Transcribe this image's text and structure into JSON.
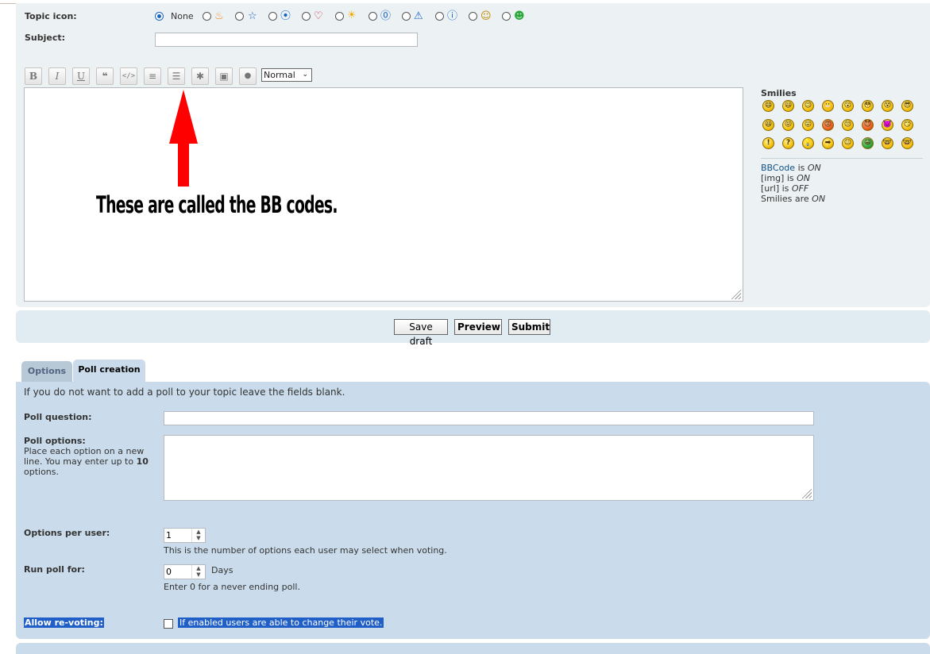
{
  "topic_icon": {
    "label": "Topic icon:",
    "none_label": "None",
    "icons": [
      "flame-icon",
      "star-icon",
      "paw-icon",
      "heart-icon",
      "sun-icon",
      "question-icon",
      "warning-icon",
      "info-icon",
      "smile-icon",
      "grin-icon"
    ]
  },
  "subject": {
    "label": "Subject:",
    "value": ""
  },
  "toolbar": {
    "bold": "B",
    "italic": "I",
    "underline": "U",
    "quote": "❝",
    "code": "</>",
    "list": "≡",
    "list_numbered": "☰",
    "list_item": "✱",
    "image": "▣",
    "color": "●",
    "font_size": "Normal"
  },
  "annotation": {
    "text": "These are called the BB codes."
  },
  "smilies": {
    "title": "Smilies",
    "rows": [
      [
        "😄",
        "😃",
        "😉",
        "😬",
        "😮",
        "😳",
        "😵",
        "😎"
      ],
      [
        "😆",
        "😝",
        "😛",
        "😡",
        "😒",
        "😈",
        "👿",
        "😏"
      ],
      [
        "!",
        "?",
        "💡",
        "➡",
        "😐",
        "😁",
        "🤓",
        "🤓"
      ]
    ]
  },
  "bbcode_status": {
    "bbcode_link": "BBCode",
    "bbcode_is": "is",
    "bbcode_value": "ON",
    "img_label": "[img] is",
    "img_value": "ON",
    "url_label": "[url] is",
    "url_value": "OFF",
    "smilies_label": "Smilies are",
    "smilies_value": "ON"
  },
  "actions": {
    "save_draft": "Save draft",
    "preview": "Preview",
    "submit": "Submit"
  },
  "tabs": [
    {
      "label": "Options",
      "active": false
    },
    {
      "label": "Poll creation",
      "active": true
    }
  ],
  "poll": {
    "intro": "If you do not want to add a poll to your topic leave the fields blank.",
    "question_label": "Poll question:",
    "question_value": "",
    "options_label": "Poll options:",
    "options_help_1": "Place each option on a new",
    "options_help_2": "line. You may enter up to",
    "options_help_max": "10",
    "options_help_3": "options.",
    "options_value": "",
    "per_user_label": "Options per user:",
    "per_user_value": "1",
    "per_user_help": "This is the number of options each user may select when voting.",
    "run_label": "Run poll for:",
    "run_value": "0",
    "run_unit": "Days",
    "run_help": "Enter 0 for a never ending poll.",
    "revote_label": "Allow re-voting:",
    "revote_help": "If enabled users are able to change their vote."
  },
  "colors": {
    "accent": "#1a65c1",
    "panel": "#cadceb",
    "panel_light": "#ecf1f3",
    "arrow": "#ff0000"
  }
}
